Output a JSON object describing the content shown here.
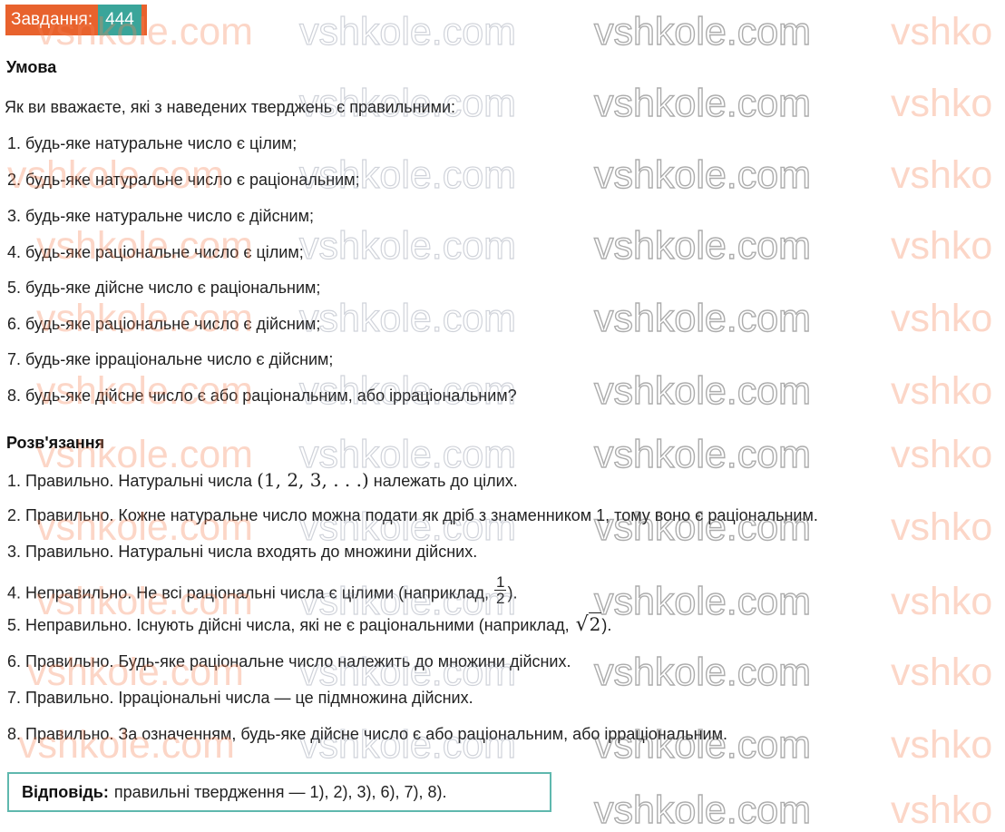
{
  "task": {
    "label": "Завдання:",
    "number": "444"
  },
  "condition": {
    "heading": "Умова",
    "intro": "Як ви вважаєте, які з наведених тверджень є правильними:",
    "items": [
      "1. будь-яке натуральне число є цілим;",
      "2. будь-яке натуральне число є раціональним;",
      "3. будь-яке натуральне число є дійсним;",
      "4. будь-яке раціональне число є цілим;",
      "5. будь-яке дійсне число є раціональним;",
      "6. будь-яке раціональне число є дійсним;",
      "7. будь-яке ірраціональне число є дійсним;",
      "8. будь-яке дійсне число є або раціональним, або ірраціональним?"
    ]
  },
  "solution": {
    "heading": "Розв'язання",
    "line1": {
      "before": "1. Правильно. Натуральні числа ",
      "math": "(1, 2, 3, . . .)",
      "after": " належать до цілих."
    },
    "line2": "2. Правильно. Кожне натуральне число можна подати як дріб з знаменником 1, тому воно є раціональним.",
    "line3": "3. Правильно. Натуральні числа входять до множини дійсних.",
    "line4": {
      "before": "4. Неправильно. Не всі раціональні числа є цілими (наприклад, ",
      "frac_num": "1",
      "frac_den": "2",
      "after": ")."
    },
    "line5": {
      "before": "5. Неправильно. Існують дійсні числа, які не є раціональними (наприклад, ",
      "sqrt_sign": "√",
      "sqrt_value": "2",
      "after": ")."
    },
    "line6": "6. Правильно. Будь-яке раціональне число належить до множини дійсних.",
    "line7": "7. Правильно. Ірраціональні числа — це підмножина дійсних.",
    "line8": "8. Правильно. За означенням, будь-яке дійсне число є або раціональним, або ірраціональним."
  },
  "answer": {
    "label": "Відповідь:",
    "text": "правильні твердження — 1), 2), 3), 6), 7), 8)."
  },
  "watermark": {
    "text": "vshkole.com",
    "text_cut": "vshko",
    "colors": {
      "orange": "#f58255",
      "outline": "#5a5a5a"
    }
  },
  "colors": {
    "badge_label_bg": "#e8622d",
    "badge_number_bg": "#3aa59a",
    "answer_border": "#5fb8ae"
  }
}
